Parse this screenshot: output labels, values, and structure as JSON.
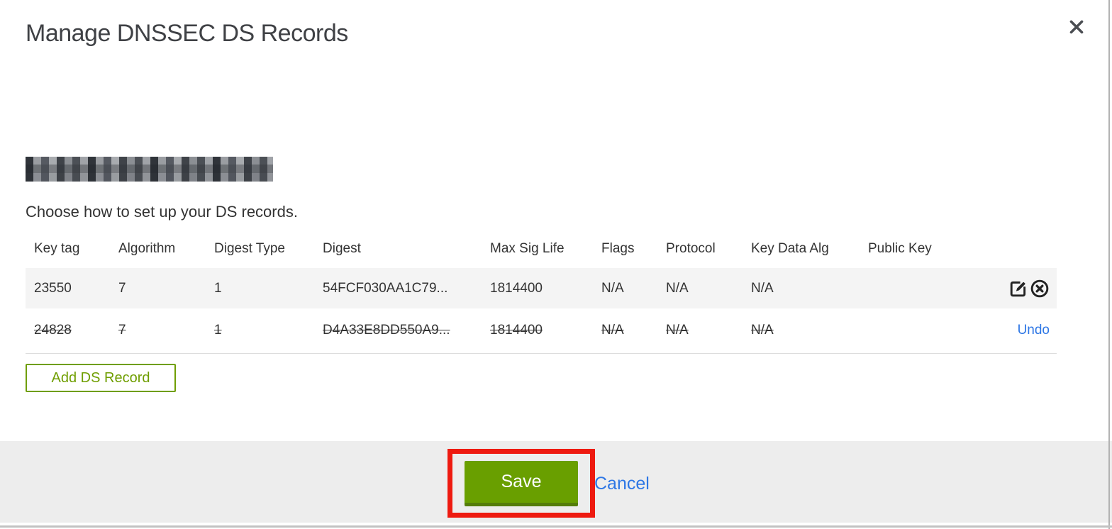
{
  "modal": {
    "title": "Manage DNSSEC DS Records",
    "subtitle": "Choose how to set up your DS records.",
    "domain_redacted": "pixelated-redacted-domain"
  },
  "table": {
    "columns": [
      "Key tag",
      "Algorithm",
      "Digest Type",
      "Digest",
      "Max Sig Life",
      "Flags",
      "Protocol",
      "Key Data Alg",
      "Public Key"
    ],
    "rows": [
      {
        "cells": [
          "23550",
          "7",
          "1",
          "54FCF030AA1C79...",
          "1814400",
          "N/A",
          "N/A",
          "N/A",
          ""
        ],
        "deleted": false,
        "actions": [
          "edit",
          "delete"
        ]
      },
      {
        "cells": [
          "24828",
          "7",
          "1",
          "D4A33E8DD550A9...",
          "1814400",
          "N/A",
          "N/A",
          "N/A",
          ""
        ],
        "deleted": true,
        "action_label": "Undo"
      }
    ]
  },
  "buttons": {
    "add_ds_record": "Add DS Record",
    "save": "Save",
    "cancel": "Cancel"
  },
  "icons": {
    "close": "close-x",
    "edit": "pencil-square",
    "delete": "x-circle"
  },
  "colors": {
    "accent_green": "#699f00",
    "green_outline": "#6f9e00",
    "link_blue": "#2e77e5",
    "annotation_red": "#ee1a10",
    "row_highlight": "#f4f4f4",
    "footer_gray": "#ededed"
  }
}
